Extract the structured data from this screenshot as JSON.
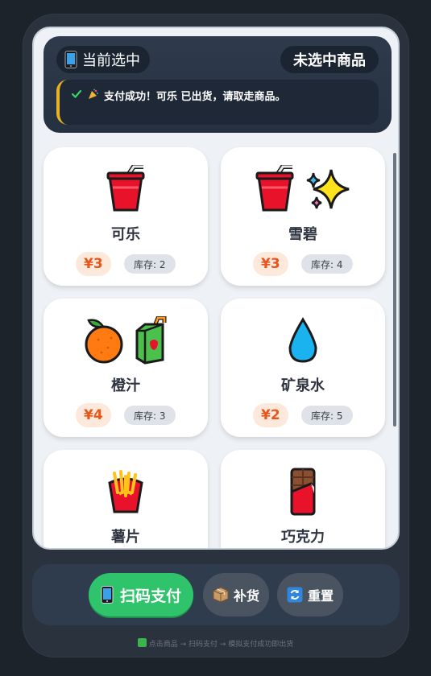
{
  "status": {
    "current_label": "当前选中",
    "selected_value": "未选中商品",
    "message": "支付成功！可乐 已出货，请取走商品。"
  },
  "products": [
    {
      "name": "可乐",
      "price": "¥3",
      "stock": "库存: 2",
      "icons": [
        "cup-with-straw-icon"
      ]
    },
    {
      "name": "雪碧",
      "price": "¥3",
      "stock": "库存: 4",
      "icons": [
        "cup-with-straw-icon",
        "sparkles-icon"
      ]
    },
    {
      "name": "橙汁",
      "price": "¥4",
      "stock": "库存: 3",
      "icons": [
        "orange-icon",
        "juice-box-icon"
      ]
    },
    {
      "name": "矿泉水",
      "price": "¥2",
      "stock": "库存: 5",
      "icons": [
        "water-drop-icon"
      ]
    },
    {
      "name": "薯片",
      "price": "",
      "stock": "",
      "icons": [
        "fries-icon"
      ]
    },
    {
      "name": "巧克力",
      "price": "",
      "stock": "",
      "icons": [
        "chocolate-bar-icon"
      ]
    }
  ],
  "controls": {
    "pay_label": "扫码支付",
    "restock_label": "补货",
    "reset_label": "重置"
  },
  "footer": {
    "hint": "点击商品 → 扫码支付 → 模拟支付成功即出货"
  },
  "colors": {
    "accent_green": "#2fc46b",
    "price_orange": "#e8561c",
    "message_border": "#e8b320"
  }
}
